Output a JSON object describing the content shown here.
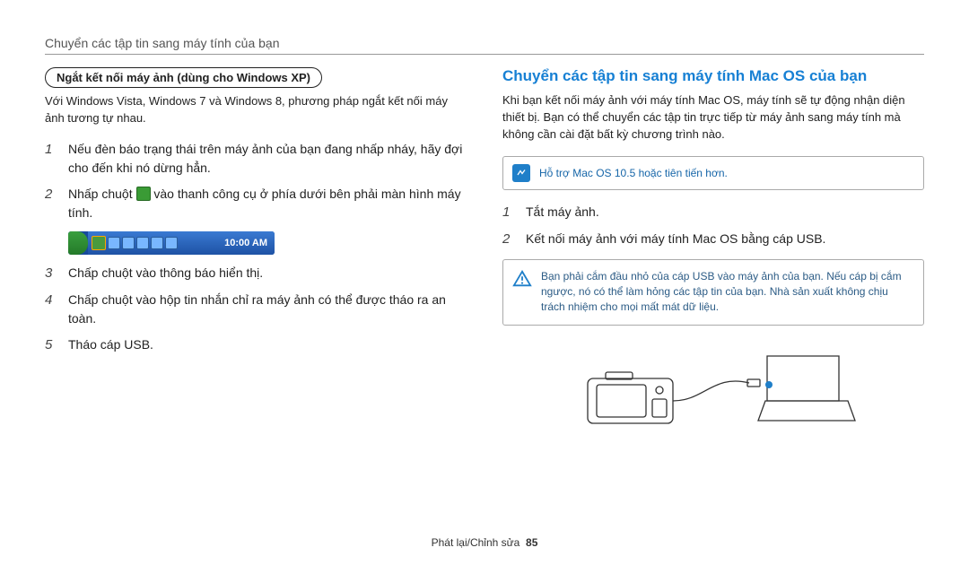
{
  "header": {
    "title": "Chuyển các tập tin sang máy tính của bạn"
  },
  "left": {
    "pill": "Ngắt kết nối máy ảnh (dùng cho Windows XP)",
    "intro": "Với Windows Vista, Windows 7 và Windows 8, phương pháp ngắt kết nối máy ảnh tương tự nhau.",
    "steps": [
      {
        "num": "1",
        "text": "Nếu đèn báo trạng thái trên máy ảnh của bạn đang nhấp nháy, hãy đợi cho đến khi nó dừng hẳn."
      },
      {
        "num": "2",
        "pre": "Nhấp chuột ",
        "post": " vào thanh công cụ ở phía dưới bên phải màn hình máy tính."
      },
      {
        "num": "3",
        "text": "Chấp chuột vào thông báo hiển thị."
      },
      {
        "num": "4",
        "text": "Chấp chuột vào hộp tin nhắn chỉ ra máy ảnh có thể được tháo ra an toàn."
      },
      {
        "num": "5",
        "text": "Tháo cáp USB."
      }
    ],
    "taskbar_time": "10:00 AM"
  },
  "right": {
    "title": "Chuyển các tập tin sang máy tính Mac OS của bạn",
    "intro": "Khi bạn kết nối máy ảnh với máy tính Mac OS, máy tính sẽ tự động nhận diện thiết bị. Bạn có thể chuyển các tập tin trực tiếp từ máy ảnh sang máy tính mà không cần cài đặt bất kỳ chương trình nào.",
    "note": "Hỗ trợ Mac OS 10.5 hoặc tiên tiến hơn.",
    "steps": [
      {
        "num": "1",
        "text": "Tắt máy ảnh."
      },
      {
        "num": "2",
        "text": "Kết nối máy ảnh với máy tính Mac OS bằng cáp USB."
      }
    ],
    "warn": "Bạn phải cắm đầu nhỏ của cáp USB vào máy ảnh của bạn. Nếu cáp bị cắm ngược, nó có thể làm hỏng các tập tin của bạn. Nhà sản xuất không chịu trách nhiệm cho mọi mất mát dữ liệu."
  },
  "footer": {
    "section": "Phát lại/Chỉnh sửa",
    "page": "85"
  }
}
